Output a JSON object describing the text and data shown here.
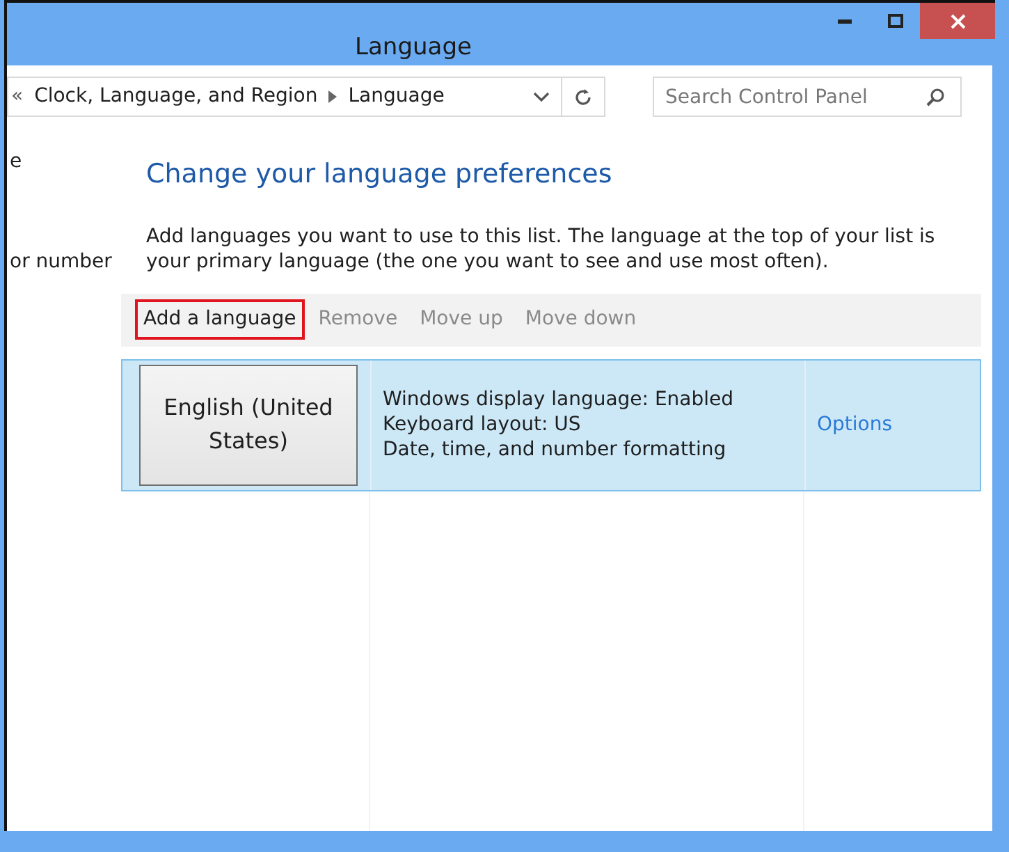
{
  "window": {
    "title": "Language",
    "controls": [
      {
        "kind": "minimize"
      },
      {
        "kind": "maximize"
      },
      {
        "kind": "close"
      }
    ]
  },
  "address_bar": {
    "overflow": "«",
    "breadcrumbs": [
      "Clock, Language, and Region",
      "Language"
    ]
  },
  "search": {
    "placeholder": "Search Control Panel"
  },
  "sidebar": {
    "items": [
      "e",
      "or number"
    ]
  },
  "heading": "Change your language preferences",
  "description": "Add languages you want to use to this list. The language at the top of your list is your primary language (the one you want to see and use most often).",
  "toolbar": [
    {
      "label": "Add a language",
      "disabled": false,
      "highlighted": true
    },
    {
      "label": "Remove",
      "disabled": true,
      "highlighted": false
    },
    {
      "label": "Move up",
      "disabled": true,
      "highlighted": false
    },
    {
      "label": "Move down",
      "disabled": true,
      "highlighted": false
    }
  ],
  "languages": [
    {
      "name": "English (United States)",
      "selected": true,
      "details": [
        "Windows display language: Enabled",
        "Keyboard layout: US",
        "Date, time, and number formatting"
      ],
      "action": "Options"
    }
  ]
}
